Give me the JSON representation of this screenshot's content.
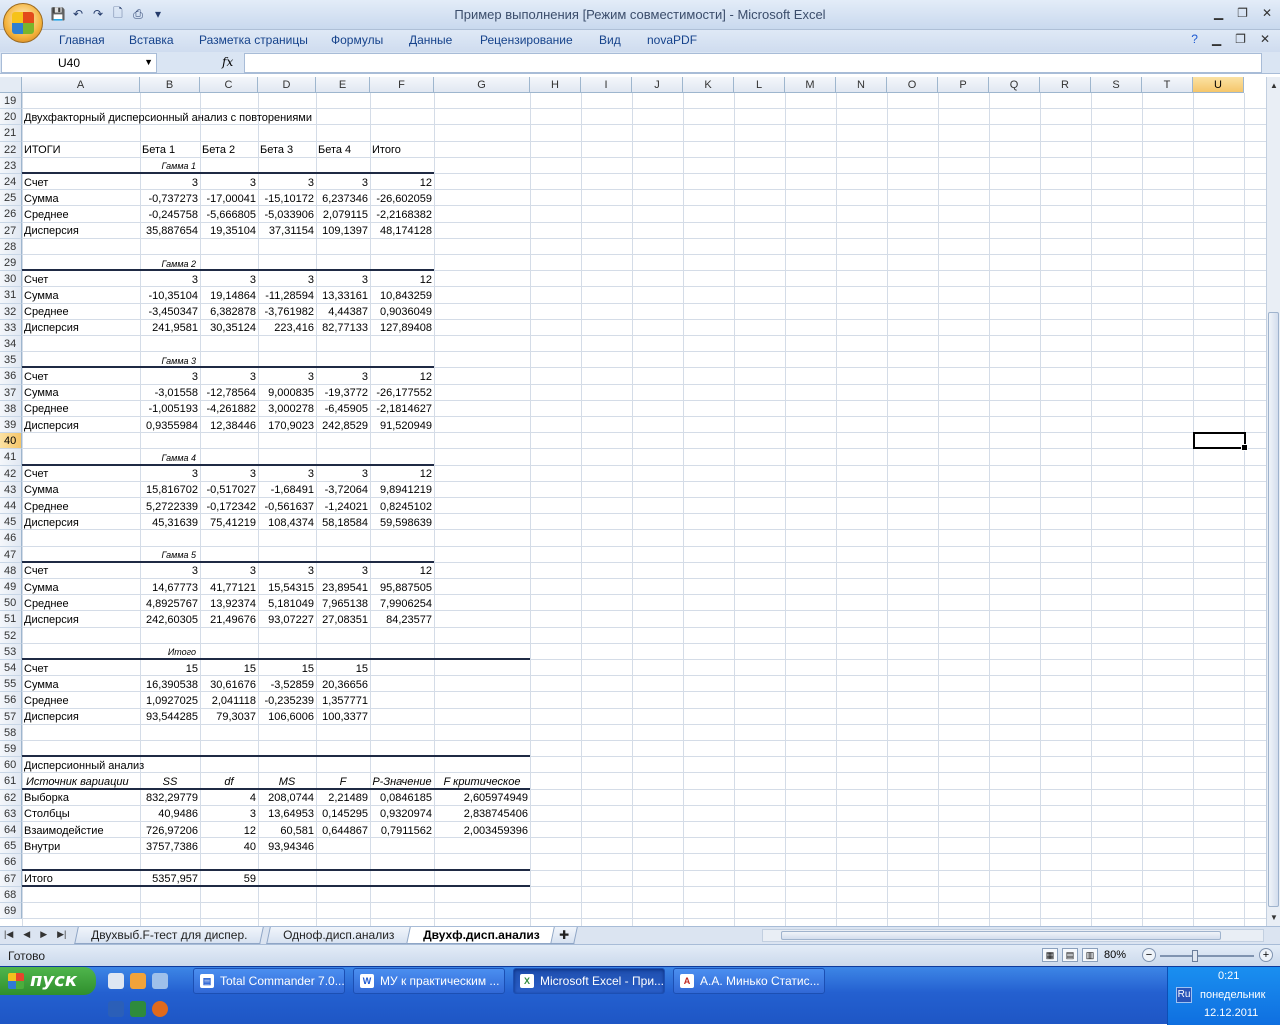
{
  "window": {
    "title": "Пример выполнения  [Режим совместимости] - Microsoft Excel",
    "minimize": "▁",
    "restore": "❐",
    "close": "✕"
  },
  "ribbon": {
    "tabs": [
      "Главная",
      "Вставка",
      "Разметка страницы",
      "Формулы",
      "Данные",
      "Рецензирование",
      "Вид",
      "novaPDF"
    ]
  },
  "formula_bar": {
    "name_box": "U40",
    "fx": "fx",
    "formula": ""
  },
  "columns": [
    "A",
    "B",
    "C",
    "D",
    "E",
    "F",
    "G",
    "H",
    "I",
    "J",
    "K",
    "L",
    "M",
    "N",
    "O",
    "P",
    "Q",
    "R",
    "S",
    "T",
    "U"
  ],
  "selected_column": "U",
  "selected_row": 40,
  "rows": [
    19,
    20,
    21,
    22,
    23,
    24,
    25,
    26,
    27,
    28,
    29,
    30,
    31,
    32,
    33,
    34,
    35,
    36,
    37,
    38,
    39,
    40,
    41,
    42,
    43,
    44,
    45,
    46,
    47,
    48,
    49,
    50,
    51,
    52,
    53,
    54,
    55,
    56,
    57,
    58,
    59,
    60,
    61,
    62,
    63,
    64,
    65,
    66,
    67,
    68,
    69
  ],
  "sheet": {
    "title_row20": "Двухфакторный дисперсионный анализ с повторениями",
    "headers_row22": [
      "ИТОГИ",
      "Бета 1",
      "Бета 2",
      "Бета 3",
      "Бета 4",
      "Итого"
    ],
    "groups": [
      {
        "label": "Гамма 1",
        "stats": [
          [
            "Счет",
            "3",
            "3",
            "3",
            "3",
            "12"
          ],
          [
            "Сумма",
            "-0,737273",
            "-17,00041",
            "-15,10172",
            "6,237346",
            "-26,602059"
          ],
          [
            "Среднее",
            "-0,245758",
            "-5,666805",
            "-5,033906",
            "2,079115",
            "-2,2168382"
          ],
          [
            "Дисперсия",
            "35,887654",
            "19,35104",
            "37,31154",
            "109,1397",
            "48,174128"
          ]
        ]
      },
      {
        "label": "Гамма 2",
        "stats": [
          [
            "Счет",
            "3",
            "3",
            "3",
            "3",
            "12"
          ],
          [
            "Сумма",
            "-10,35104",
            "19,14864",
            "-11,28594",
            "13,33161",
            "10,843259"
          ],
          [
            "Среднее",
            "-3,450347",
            "6,382878",
            "-3,761982",
            "4,44387",
            "0,9036049"
          ],
          [
            "Дисперсия",
            "241,9581",
            "30,35124",
            "223,416",
            "82,77133",
            "127,89408"
          ]
        ]
      },
      {
        "label": "Гамма 3",
        "stats": [
          [
            "Счет",
            "3",
            "3",
            "3",
            "3",
            "12"
          ],
          [
            "Сумма",
            "-3,01558",
            "-12,78564",
            "9,000835",
            "-19,3772",
            "-26,177552"
          ],
          [
            "Среднее",
            "-1,005193",
            "-4,261882",
            "3,000278",
            "-6,45905",
            "-2,1814627"
          ],
          [
            "Дисперсия",
            "0,9355984",
            "12,38446",
            "170,9023",
            "242,8529",
            "91,520949"
          ]
        ]
      },
      {
        "label": "Гамма 4",
        "stats": [
          [
            "Счет",
            "3",
            "3",
            "3",
            "3",
            "12"
          ],
          [
            "Сумма",
            "15,816702",
            "-0,517027",
            "-1,68491",
            "-3,72064",
            "9,8941219"
          ],
          [
            "Среднее",
            "5,2722339",
            "-0,172342",
            "-0,561637",
            "-1,24021",
            "0,8245102"
          ],
          [
            "Дисперсия",
            "45,31639",
            "75,41219",
            "108,4374",
            "58,18584",
            "59,598639"
          ]
        ]
      },
      {
        "label": "Гамма 5",
        "stats": [
          [
            "Счет",
            "3",
            "3",
            "3",
            "3",
            "12"
          ],
          [
            "Сумма",
            "14,67773",
            "41,77121",
            "15,54315",
            "23,89541",
            "95,887505"
          ],
          [
            "Среднее",
            "4,8925767",
            "13,92374",
            "5,181049",
            "7,965138",
            "7,9906254"
          ],
          [
            "Дисперсия",
            "242,60305",
            "21,49676",
            "93,07227",
            "27,08351",
            "84,23577"
          ]
        ]
      },
      {
        "label": "Итого",
        "stats": [
          [
            "Счет",
            "15",
            "15",
            "15",
            "15"
          ],
          [
            "Сумма",
            "16,390538",
            "30,61676",
            "-3,52859",
            "20,36656"
          ],
          [
            "Среднее",
            "1,0927025",
            "2,041118",
            "-0,235239",
            "1,357771"
          ],
          [
            "Дисперсия",
            "93,544285",
            "79,3037",
            "106,6006",
            "100,3377"
          ]
        ]
      }
    ],
    "anova_title": "Дисперсионный анализ",
    "anova_headers": [
      "Источник вариации",
      "SS",
      "df",
      "MS",
      "F",
      "P-Значение",
      "F критическое"
    ],
    "anova_rows": [
      [
        "Выборка",
        "832,29779",
        "4",
        "208,0744",
        "2,21489",
        "0,0846185",
        "2,605974949"
      ],
      [
        "Столбцы",
        "40,9486",
        "3",
        "13,64953",
        "0,145295",
        "0,9320974",
        "2,838745406"
      ],
      [
        "Взаимодейстие",
        "726,97206",
        "12",
        "60,581",
        "0,644867",
        "0,7911562",
        "2,003459396"
      ],
      [
        "Внутри",
        "3757,7386",
        "40",
        "93,94346",
        "",
        "",
        ""
      ]
    ],
    "anova_total": [
      "Итого",
      "5357,957",
      "59"
    ]
  },
  "sheet_tabs": [
    "Двухвыб.F-тест для диспер.",
    "Одноф.дисп.анализ",
    "Двухф.дисп.анализ"
  ],
  "active_sheet_tab": "Двухф.дисп.анализ",
  "status": {
    "text": "Готово",
    "zoom": "80%"
  },
  "taskbar": {
    "start": "пуск",
    "tasks": [
      "Total Commander 7.0...",
      "МУ к практическим ...",
      "Microsoft Excel - При...",
      "А.А. Минько Статис..."
    ],
    "active_task": "Microsoft Excel - При...",
    "lang": "Ru",
    "time": "0:21",
    "day": "понедельник",
    "date": "12.12.2011"
  }
}
